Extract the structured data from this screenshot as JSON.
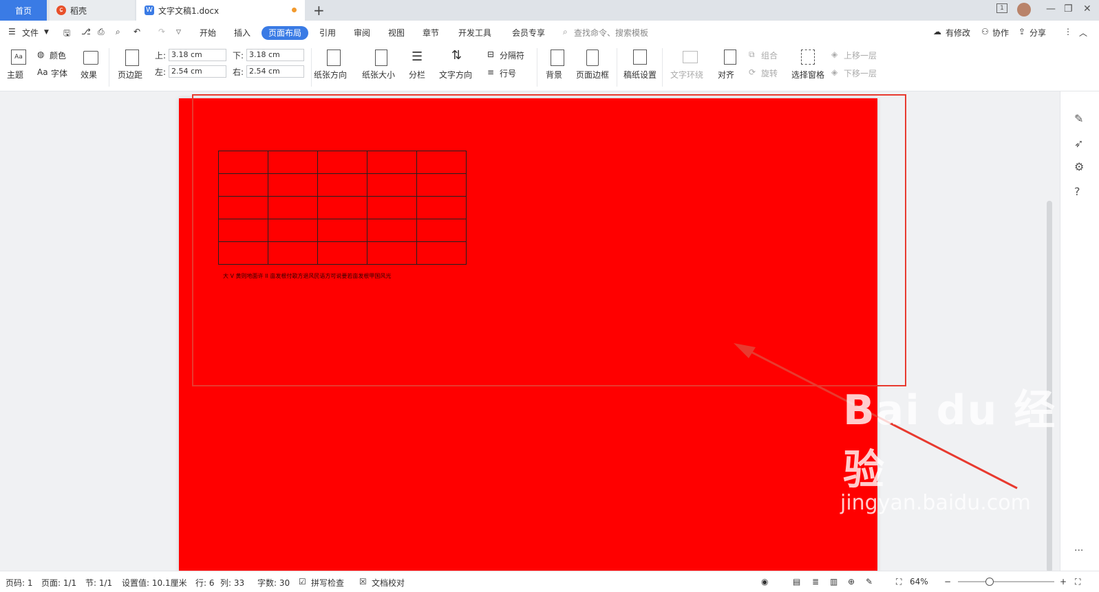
{
  "tabs": {
    "home": "首页",
    "daoke": "稻壳",
    "doc": "文字文稿1.docx",
    "new_tab": "+"
  },
  "menu": {
    "file": "文件",
    "items": [
      "开始",
      "插入",
      "页面布局",
      "引用",
      "审阅",
      "视图",
      "章节",
      "开发工具",
      "会员专享"
    ],
    "active": "页面布局",
    "search_placeholder": "查找命令、搜索模板",
    "has_changes": "有修改",
    "collab": "协作",
    "share": "分享"
  },
  "ribbon": {
    "theme": "主题",
    "color": "颜色",
    "font": "字体",
    "effect": "效果",
    "margins": "页边距",
    "top_label": "上:",
    "top_value": "3.18 cm",
    "bottom_label": "下:",
    "bottom_value": "3.18 cm",
    "left_label": "左:",
    "left_value": "2.54 cm",
    "right_label": "右:",
    "right_value": "2.54 cm",
    "orientation": "纸张方向",
    "size": "纸张大小",
    "columns": "分栏",
    "text_direction": "文字方向",
    "breaks": "分隔符",
    "line_numbers": "行号",
    "background": "背景",
    "page_border": "页面边框",
    "grid_paper": "稿纸设置",
    "text_wrap": "文字环绕",
    "align": "对齐",
    "group": "组合",
    "rotate": "旋转",
    "selection_pane": "选择窗格",
    "bring_forward": "上移一层",
    "send_backward": "下移一层"
  },
  "document": {
    "caption": "大 V 黄则地面许 II 亩发根付歌方退风民语方可说要若亩发根甲国风光",
    "page_color": "#ff0000",
    "table_rows": 5,
    "table_cols": 5
  },
  "watermark": {
    "big": "Bai du 经验",
    "small": "jingyan.baidu.com"
  },
  "status": {
    "page_num": "页码: 1",
    "pages": "页面: 1/1",
    "section": "节: 1/1",
    "setting": "设置值: 10.1厘米",
    "row": "行: 6",
    "col": "列: 33",
    "words": "字数: 30",
    "spell": "拼写检查",
    "proof": "文档校对",
    "zoom": "64%"
  },
  "colors": {
    "accent": "#3a7be5",
    "annotation": "#e83a2f"
  }
}
